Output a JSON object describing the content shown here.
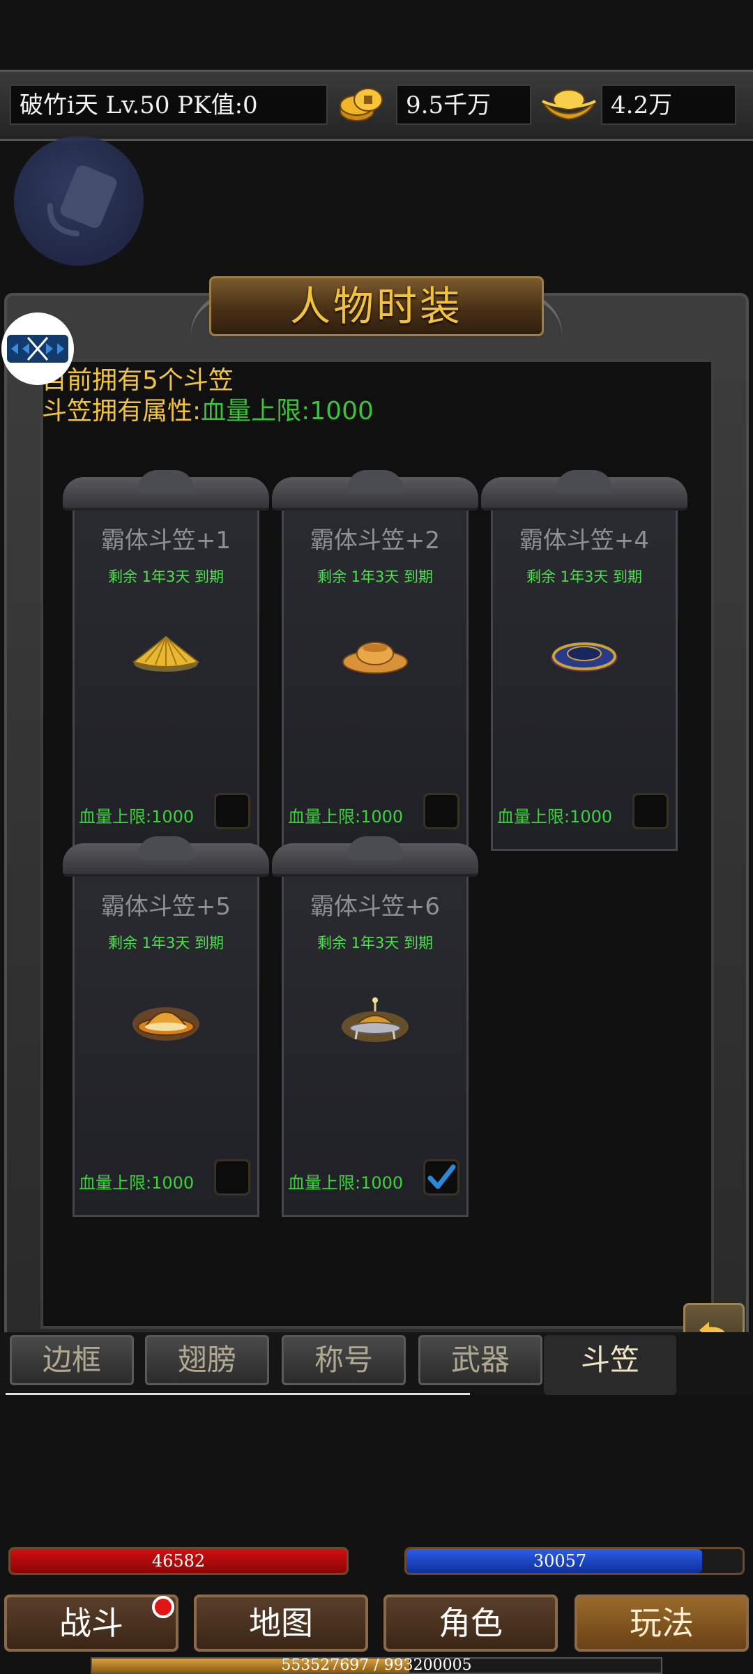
{
  "topbar": {
    "player_info": "破竹i天  Lv.50 PK值:0",
    "coins": "9.5千万",
    "ingots": "4.2万"
  },
  "panel": {
    "title": "人物时装",
    "owned_text": "目前拥有5个斗笠",
    "attr_label": "斗笠拥有属性:",
    "attr_value": "血量上限:1000"
  },
  "cards": [
    {
      "name": "霸体斗笠+1",
      "remain": "剩余 1年3天 到期",
      "stat": "血量上限:1000",
      "checked": false
    },
    {
      "name": "霸体斗笠+2",
      "remain": "剩余 1年3天 到期",
      "stat": "血量上限:1000",
      "checked": false
    },
    {
      "name": "霸体斗笠+4",
      "remain": "剩余 1年3天 到期",
      "stat": "血量上限:1000",
      "checked": false
    },
    {
      "name": "霸体斗笠+5",
      "remain": "剩余 1年3天 到期",
      "stat": "血量上限:1000",
      "checked": false
    },
    {
      "name": "霸体斗笠+6",
      "remain": "剩余 1年3天 到期",
      "stat": "血量上限:1000",
      "checked": true
    }
  ],
  "tabs": [
    {
      "label": "边框"
    },
    {
      "label": "翅膀"
    },
    {
      "label": "称号"
    },
    {
      "label": "武器"
    },
    {
      "label": "斗笠",
      "active": true
    }
  ],
  "hud": {
    "hp": "46582",
    "mp": "30057",
    "mp_fill_fraction": 0.88,
    "exp": "553527697 / 993200005",
    "exp_fill_fraction": 0.557
  },
  "nav": [
    {
      "label": "战斗",
      "badge": true
    },
    {
      "label": "地图"
    },
    {
      "label": "角色"
    },
    {
      "label": "玩法",
      "active": true
    }
  ],
  "colors": {
    "title_gold": "#f3c23b",
    "stat_green": "#3cd23c",
    "check_blue": "#2a8ad8"
  }
}
